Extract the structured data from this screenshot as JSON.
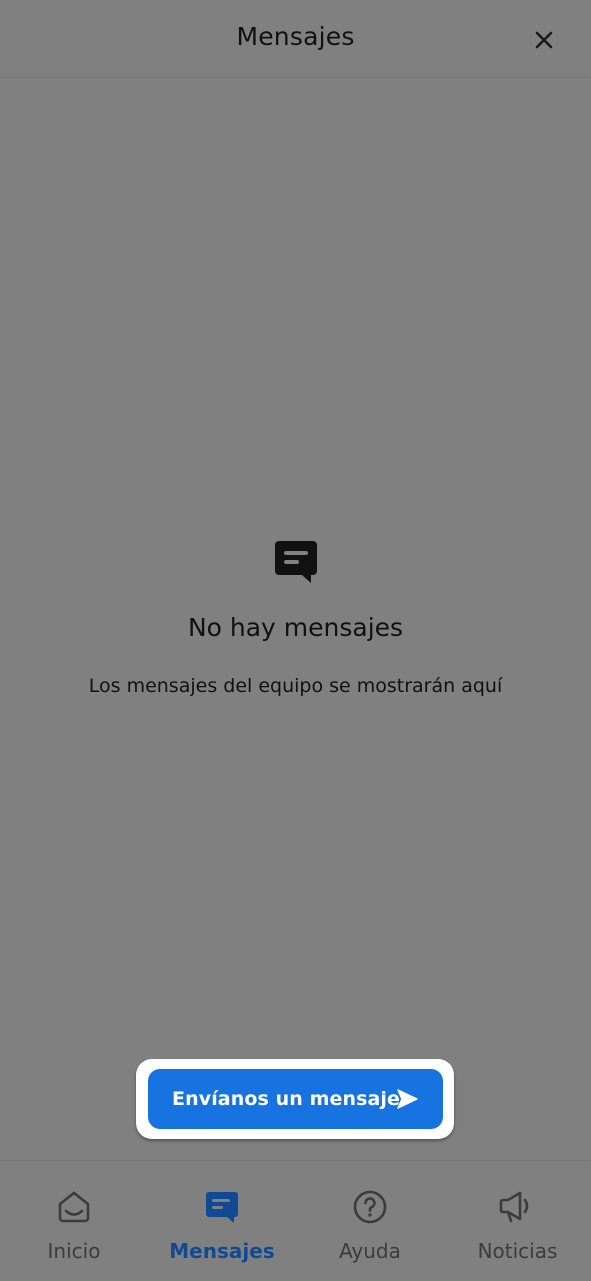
{
  "header": {
    "title": "Mensajes",
    "close_icon": "close-icon"
  },
  "empty_state": {
    "icon": "message-icon",
    "title": "No hay mensajes",
    "subtitle": "Los mensajes del equipo se mostrarán aquí"
  },
  "cta": {
    "label": "Envíanos un mensaje",
    "icon": "send-icon",
    "color": "#1673df"
  },
  "tabbar": {
    "active_color": "#0f4a93",
    "tabs": [
      {
        "label": "Inicio",
        "icon": "home-icon",
        "active": false
      },
      {
        "label": "Mensajes",
        "icon": "message-icon",
        "active": true
      },
      {
        "label": "Ayuda",
        "icon": "help-icon",
        "active": false
      },
      {
        "label": "Noticias",
        "icon": "megaphone-icon",
        "active": false
      }
    ]
  }
}
